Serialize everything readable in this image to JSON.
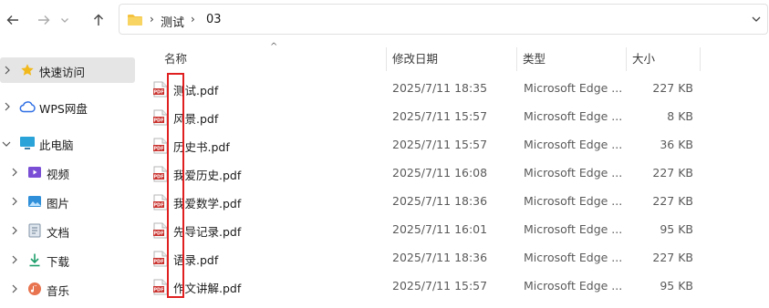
{
  "breadcrumb": [
    "测试",
    "03"
  ],
  "nav": {
    "items": [
      {
        "label": "快速访问",
        "icon": "star-icon"
      },
      {
        "label": "WPS网盘",
        "icon": "cloud-icon"
      },
      {
        "label": "此电脑",
        "icon": "pc-icon"
      },
      {
        "label": "视频",
        "icon": "video-icon"
      },
      {
        "label": "图片",
        "icon": "picture-icon"
      },
      {
        "label": "文档",
        "icon": "document-icon"
      },
      {
        "label": "下载",
        "icon": "download-icon"
      },
      {
        "label": "音乐",
        "icon": "music-icon"
      }
    ]
  },
  "columns": {
    "name": "名称",
    "date": "修改日期",
    "type": "类型",
    "size": "大小"
  },
  "files": [
    {
      "name": "测试.pdf",
      "date": "2025/7/11 18:35",
      "type": "Microsoft Edge ...",
      "size": "227 KB"
    },
    {
      "name": "风景.pdf",
      "date": "2025/7/11 15:57",
      "type": "Microsoft Edge ...",
      "size": "8 KB"
    },
    {
      "name": "历史书.pdf",
      "date": "2025/7/11 15:57",
      "type": "Microsoft Edge ...",
      "size": "36 KB"
    },
    {
      "name": "我爱历史.pdf",
      "date": "2025/7/11 16:08",
      "type": "Microsoft Edge ...",
      "size": "227 KB"
    },
    {
      "name": "我爱数学.pdf",
      "date": "2025/7/11 18:36",
      "type": "Microsoft Edge ...",
      "size": "227 KB"
    },
    {
      "name": "先导记录.pdf",
      "date": "2025/7/11 16:01",
      "type": "Microsoft Edge ...",
      "size": "95 KB"
    },
    {
      "name": "语录.pdf",
      "date": "2025/7/11 18:36",
      "type": "Microsoft Edge ...",
      "size": "227 KB"
    },
    {
      "name": "作文讲解.pdf",
      "date": "2025/7/11 15:57",
      "type": "Microsoft Edge ...",
      "size": "95 KB"
    }
  ],
  "file_icon_label": "PDF",
  "highlight_color": "#e02020"
}
